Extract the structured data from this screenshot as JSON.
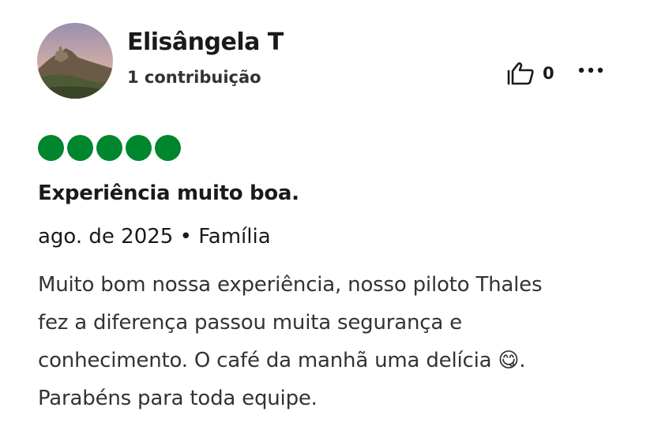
{
  "review": {
    "author": "Elisângela T",
    "contributions": "1 contribuição",
    "helpful_count": "0",
    "rating": 5,
    "rating_max": 5,
    "title": "Experiência muito boa.",
    "meta": "ago. de 2025 • Família",
    "body_lines": [
      "Muito bom nossa experiência, nosso piloto Thales",
      "fez a diferença passou muita segurança e",
      "conhecimento. O café da manhã uma delícia 😋.",
      "Parabéns para toda equipe."
    ]
  },
  "icons": {
    "helpful": "thumbs-up-icon",
    "more": "more-options-icon",
    "rating": "rating-bubble-icon"
  },
  "colors": {
    "rating_fill": "#00862d",
    "text_primary": "#1a1a1a",
    "text_secondary": "#333333"
  }
}
